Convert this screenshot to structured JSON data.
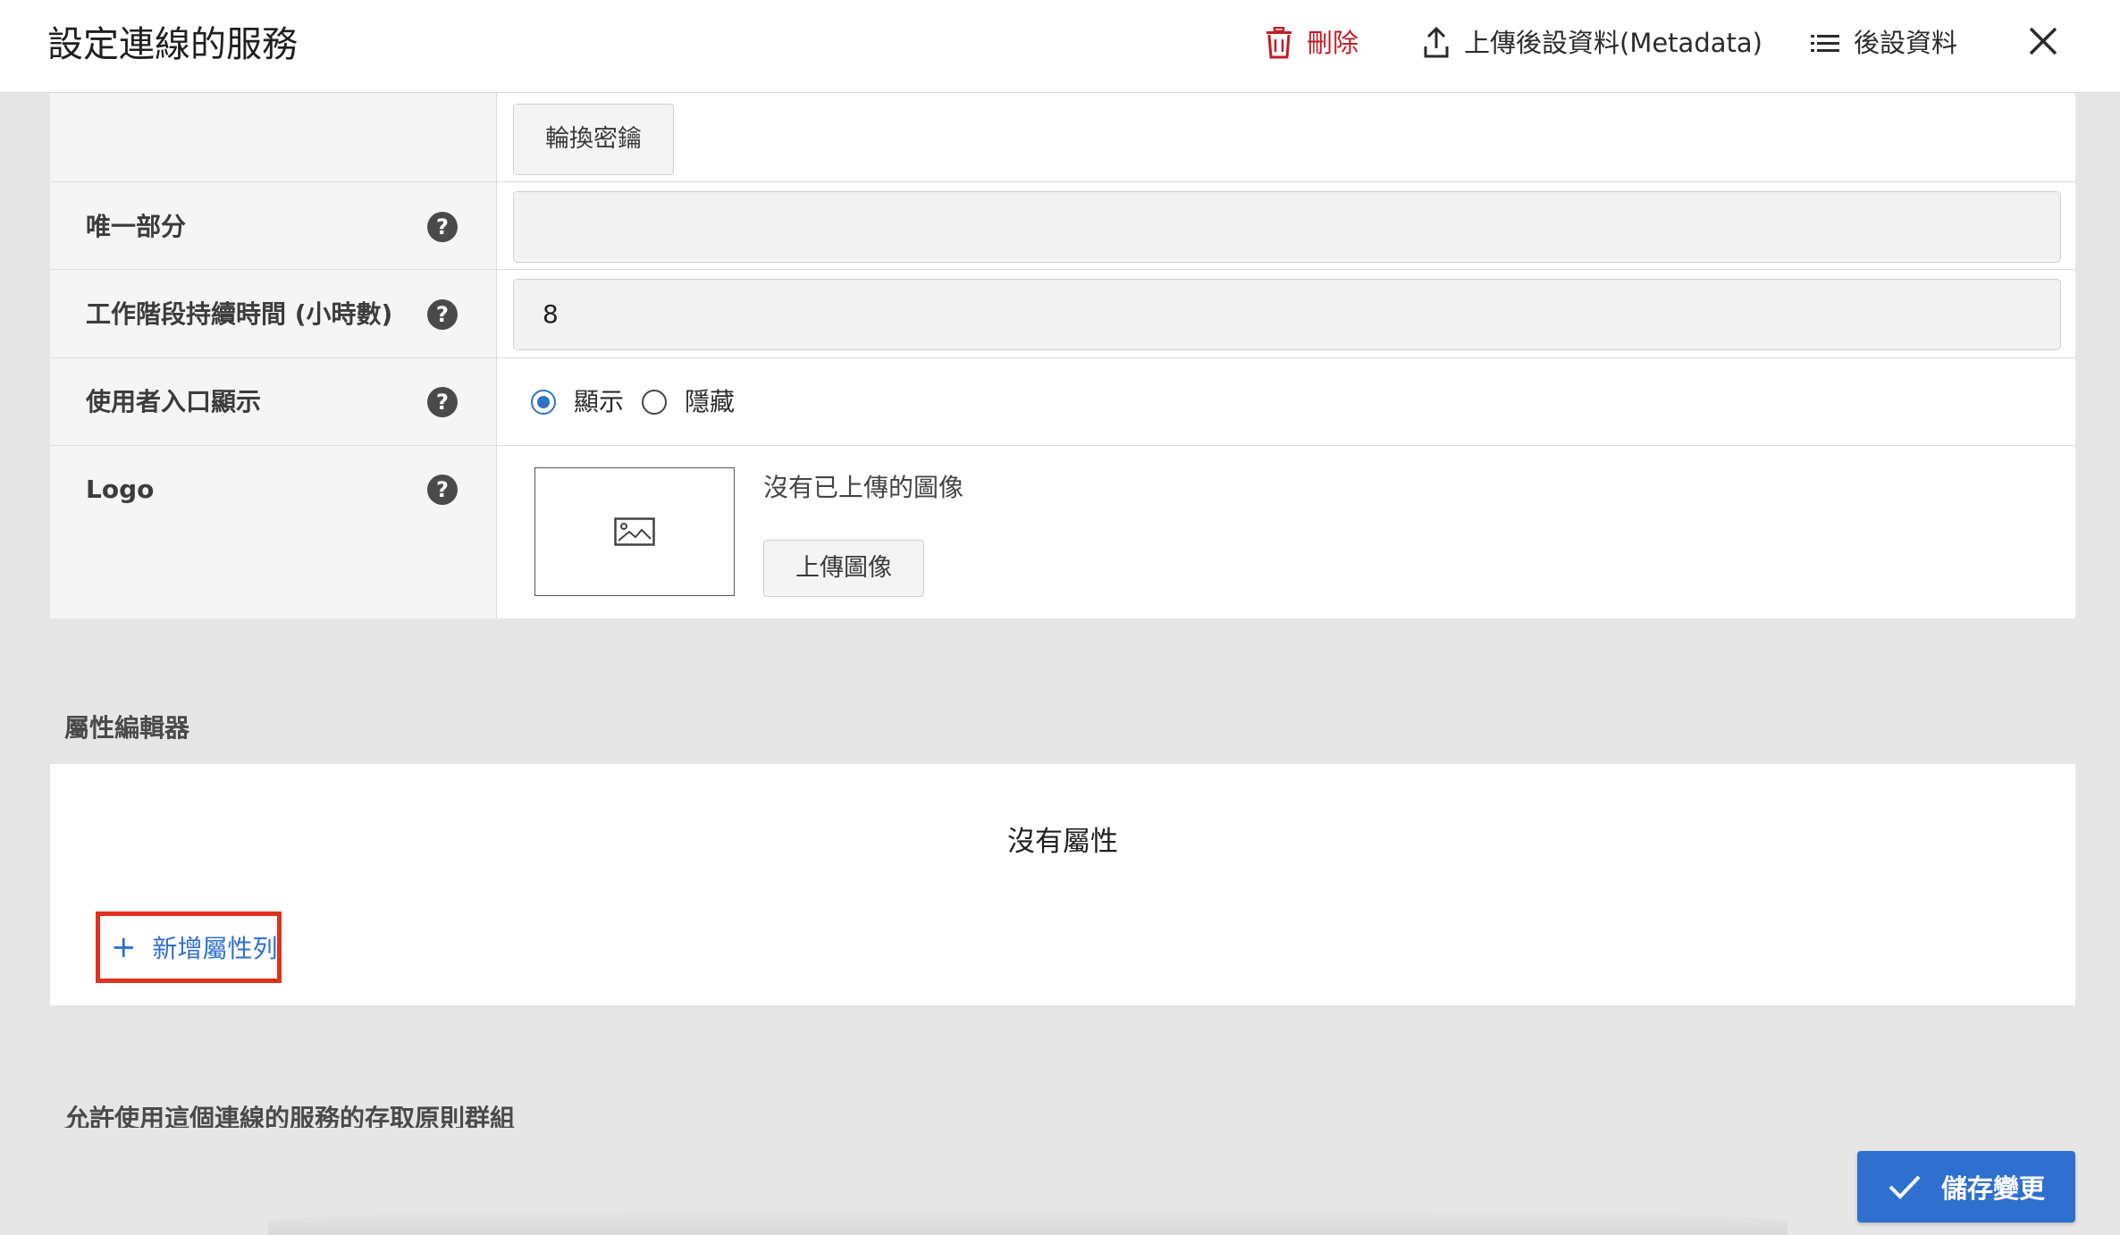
{
  "header": {
    "title": "設定連線的服務",
    "delete_label": "刪除",
    "upload_metadata_label": "上傳後設資料(Metadata)",
    "metadata_label": "後設資料",
    "delete_color": "#c21d26"
  },
  "form": {
    "rotate_key_button": "輪換密鑰",
    "rows": [
      {
        "label": "唯一部分",
        "help": "?",
        "value": ""
      },
      {
        "label": "工作階段持續時間 (小時數)",
        "help": "?",
        "value": "8"
      },
      {
        "label": "使用者入口顯示",
        "help": "?"
      },
      {
        "label": "Logo",
        "help": "?"
      }
    ],
    "portal_display": {
      "options": [
        "顯示",
        "隱藏"
      ],
      "selected": "顯示"
    },
    "logo": {
      "no_image_text": "沒有已上傳的圖像",
      "upload_button": "上傳圖像",
      "icon": "image-icon"
    }
  },
  "attribute_editor": {
    "title": "屬性編輯器",
    "empty_text": "沒有屬性",
    "add_row_label": "新增屬性列",
    "add_icon": "+"
  },
  "access_policy_section": {
    "title": "允許使用這個連線的服務的存取原則群組"
  },
  "save_button": {
    "label": "儲存變更",
    "color": "#2f6fd0"
  }
}
